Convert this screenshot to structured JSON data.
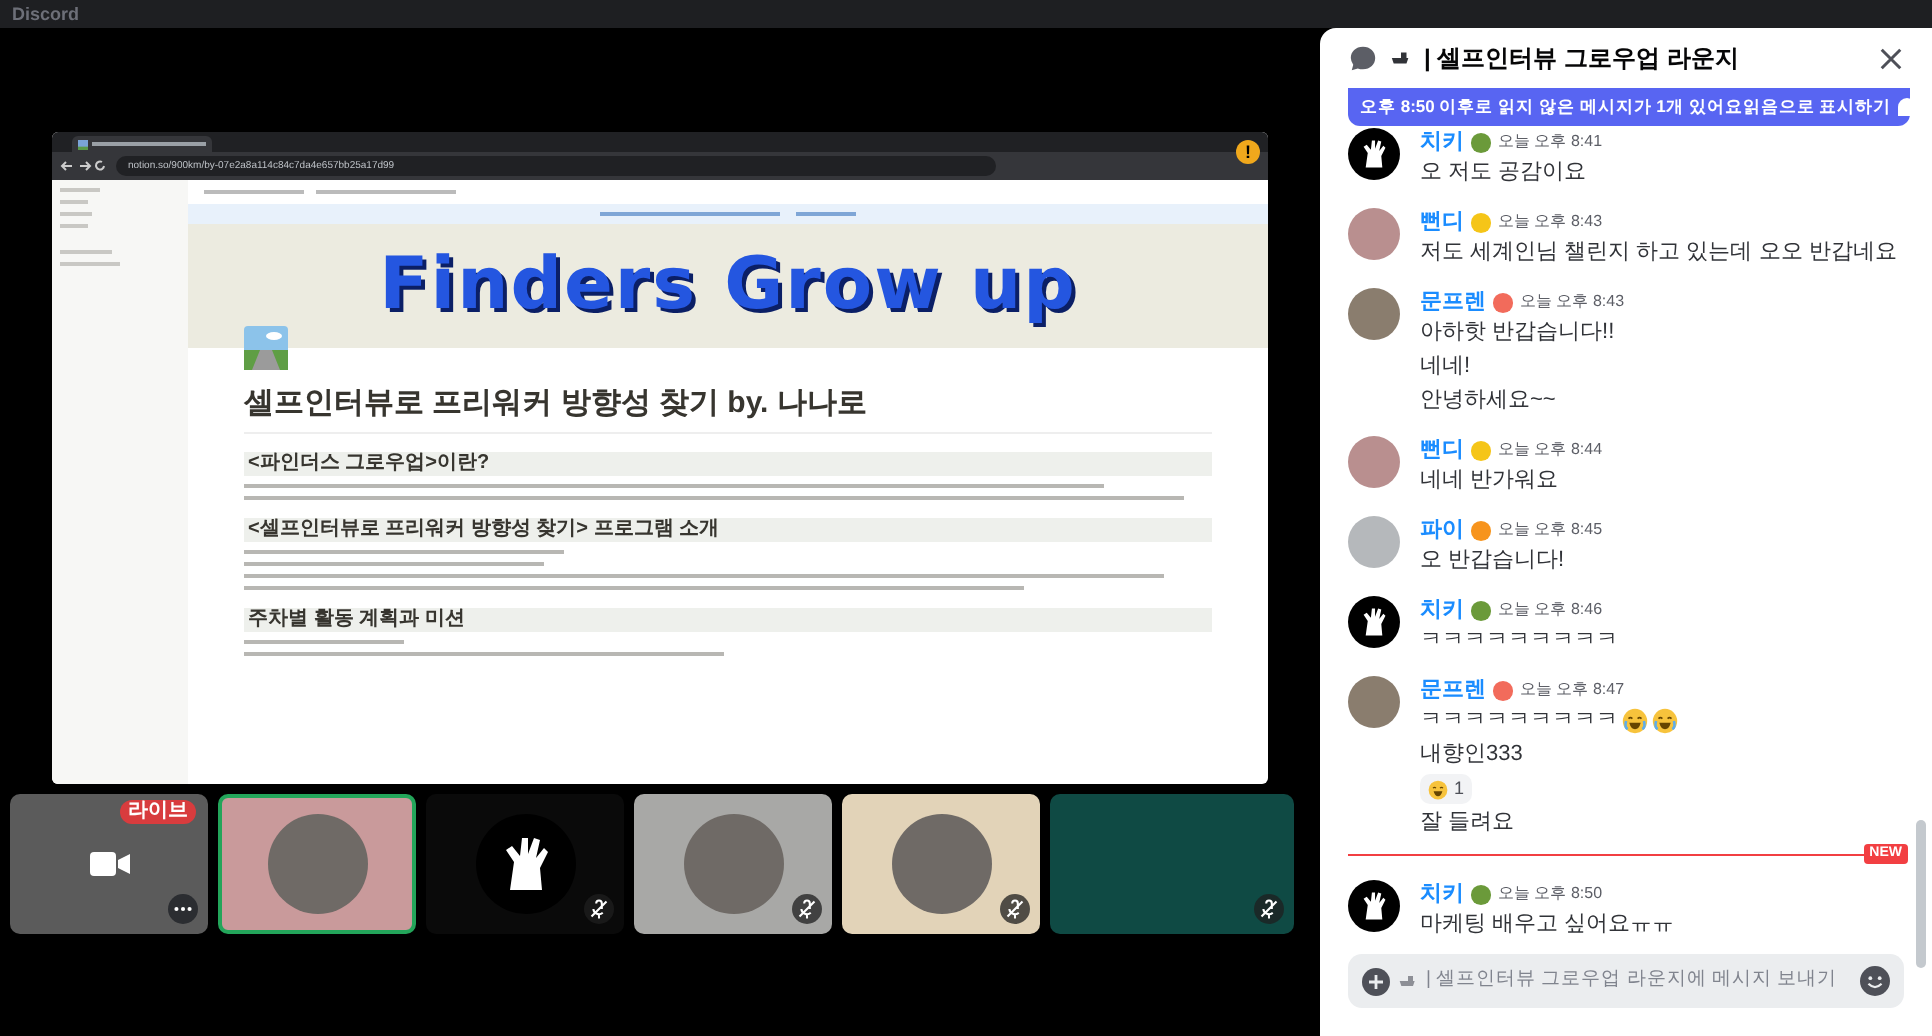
{
  "window": {
    "title": "Discord"
  },
  "stage": {
    "screen_share": {
      "url": "notion.so/900km/by-07e2a8a114c84c7da4e657bb25a17d99",
      "cover_title": "Finders Grow up",
      "page_title": "셀프인터뷰로 프리워커 방향성 찾기 by. 나나로",
      "sections": [
        {
          "heading": "<파인더스 그로우업>이란?"
        },
        {
          "heading": "<셀프인터뷰로 프리워커 방향성 찾기> 프로그램 소개"
        },
        {
          "heading": "주차별 활동 계획과 미션"
        }
      ],
      "warning": "!"
    },
    "tiles": [
      {
        "kind": "screen",
        "badge": "라이브",
        "muted": false,
        "speaking": false,
        "color": "#5b5b5b"
      },
      {
        "kind": "avatar",
        "muted": false,
        "speaking": true,
        "color": "#c99a9b"
      },
      {
        "kind": "logo",
        "muted": true,
        "speaking": false,
        "color": "#0a0a0a"
      },
      {
        "kind": "avatar",
        "muted": true,
        "speaking": false,
        "color": "#a8a8a6"
      },
      {
        "kind": "avatar",
        "muted": true,
        "speaking": false,
        "color": "#e2d3b8"
      },
      {
        "kind": "video",
        "muted": true,
        "speaking": false,
        "color": "#0f4a44"
      }
    ]
  },
  "chat": {
    "channel": "| 셀프인터뷰 그로우업 라운지",
    "unread_banner": {
      "text": "오후 8:50 이후로 읽지 않은 메시지가 1개 있어요",
      "action": "읽음으로 표시하기"
    },
    "messages": [
      {
        "kind": "group",
        "author": "치키",
        "color": "#6b9a3a",
        "avatar": {
          "kind": "logo",
          "color": "#000000"
        },
        "time": "오늘 오후 8:41",
        "lines": [
          {
            "kind": "text",
            "text": "오 저도 공감이요"
          }
        ]
      },
      {
        "kind": "group",
        "author": "뻔디",
        "color": "#f5c518",
        "avatar": {
          "kind": "photo",
          "color": "#b98f8f"
        },
        "time": "오늘 오후 8:43",
        "lines": [
          {
            "kind": "text",
            "text": "저도 세계인님 챌린지 하고 있는데 오오 반갑네요"
          }
        ]
      },
      {
        "kind": "group",
        "author": "문프렌",
        "color": "#f26b5b",
        "avatar": {
          "kind": "photo",
          "color": "#8a7d6e"
        },
        "time": "오늘 오후 8:43",
        "lines": [
          {
            "kind": "text",
            "text": "아하핫 반갑습니다!!"
          },
          {
            "kind": "text",
            "text": "네네!"
          },
          {
            "kind": "text",
            "text": "안녕하세요~~"
          }
        ]
      },
      {
        "kind": "group",
        "author": "뻔디",
        "color": "#f5c518",
        "avatar": {
          "kind": "photo",
          "color": "#b98f8f"
        },
        "time": "오늘 오후 8:44",
        "lines": [
          {
            "kind": "text",
            "text": "네네 반가워요"
          }
        ]
      },
      {
        "kind": "group",
        "author": "파이",
        "color": "#f7941d",
        "avatar": {
          "kind": "photo",
          "color": "#b5b8bb"
        },
        "time": "오늘 오후 8:45",
        "lines": [
          {
            "kind": "text",
            "text": "오 반갑습니다!"
          }
        ]
      },
      {
        "kind": "group",
        "author": "치키",
        "color": "#6b9a3a",
        "avatar": {
          "kind": "logo",
          "color": "#000000"
        },
        "time": "오늘 오후 8:46",
        "lines": [
          {
            "kind": "text",
            "text": "ㅋㅋㅋㅋㅋㅋㅋㅋㅋ"
          }
        ]
      },
      {
        "kind": "group",
        "author": "문프렌",
        "color": "#f26b5b",
        "avatar": {
          "kind": "photo",
          "color": "#8a7d6e"
        },
        "time": "오늘 오후 8:47",
        "lines": [
          {
            "kind": "text-emoji",
            "text": "ㅋㅋㅋㅋㅋㅋㅋㅋㅋ"
          },
          {
            "kind": "text",
            "text": "내향인333"
          },
          {
            "kind": "reaction",
            "text": "1"
          },
          {
            "kind": "text",
            "text": "잘 들려요"
          }
        ]
      },
      {
        "kind": "divider",
        "label": "NEW"
      },
      {
        "kind": "group",
        "author": "치키",
        "color": "#6b9a3a",
        "avatar": {
          "kind": "logo",
          "color": "#000000"
        },
        "time": "오늘 오후 8:50",
        "lines": [
          {
            "kind": "text",
            "text": "마케팅 배우고 싶어요ㅠㅠ"
          }
        ]
      }
    ],
    "composer": {
      "placeholder": "| 셀프인터뷰 그로우업 라운지에 메시지 보내기"
    }
  }
}
